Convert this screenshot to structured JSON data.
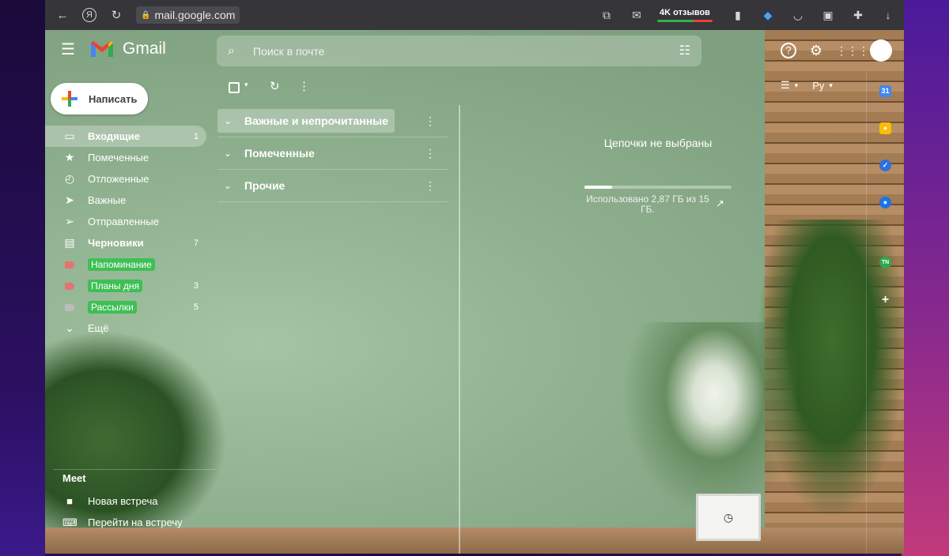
{
  "browser": {
    "url": "mail.google.com",
    "reviews_label": "4K отзывов"
  },
  "gmail": {
    "brand": "Gmail",
    "search_placeholder": "Поиск в почте",
    "compose_label": "Написать",
    "nav": [
      {
        "label": "Входящие",
        "count": "1",
        "icon": "inbox-icon",
        "active": true,
        "bold": true
      },
      {
        "label": "Помеченные",
        "count": "",
        "icon": "star-icon"
      },
      {
        "label": "Отложенные",
        "count": "",
        "icon": "clock-icon"
      },
      {
        "label": "Важные",
        "count": "",
        "icon": "label-important-icon"
      },
      {
        "label": "Отправленные",
        "count": "",
        "icon": "send-icon"
      },
      {
        "label": "Черновики",
        "count": "7",
        "icon": "draft-icon",
        "bold": true
      },
      {
        "label": "Напоминание",
        "count": "",
        "icon": "label-tag-icon",
        "color": "#e57373"
      },
      {
        "label": "Планы дня",
        "count": "3",
        "icon": "label-tag-icon",
        "color": "#e57373"
      },
      {
        "label": "Рассылки",
        "count": "5",
        "icon": "label-tag-icon",
        "color": "#bdbdbd"
      },
      {
        "label": "Ещё",
        "count": "",
        "icon": "chevron-down-icon"
      }
    ],
    "meet": {
      "title": "Meet",
      "items": [
        {
          "label": "Новая встреча",
          "icon": "videocam-icon"
        },
        {
          "label": "Перейти на встречу",
          "icon": "keyboard-icon"
        }
      ]
    },
    "sections": [
      {
        "label": "Важные и непрочитанные",
        "active": true
      },
      {
        "label": "Помеченные"
      },
      {
        "label": "Прочие"
      }
    ],
    "no_threads": "Цепочки не выбраны",
    "storage": {
      "used_fraction": 0.19,
      "text": "Использовано 2,87 ГБ из 15 ГБ."
    },
    "language_toggle": "Ру"
  }
}
